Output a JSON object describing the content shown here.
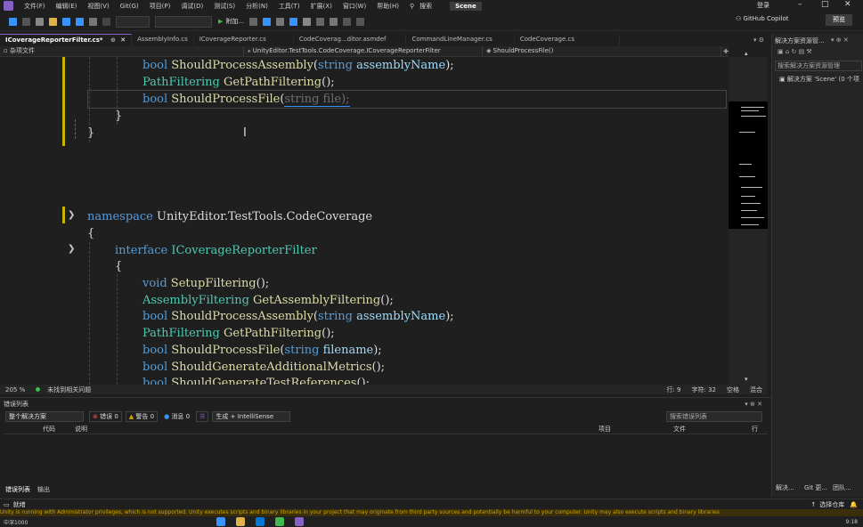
{
  "menu": {
    "items": [
      "文件(F)",
      "编辑(E)",
      "视图(V)",
      "Git(G)",
      "项目(P)",
      "调试(D)",
      "测试(S)",
      "分析(N)",
      "工具(T)",
      "扩展(X)",
      "窗口(W)",
      "帮助(H)"
    ],
    "search": "搜索",
    "solution_name": "Scene",
    "login": "登录"
  },
  "toolbar": {
    "attach": "附加...",
    "copilot": "GitHub Copilot",
    "preview": "预览"
  },
  "tabs": [
    {
      "label": "ICoverageReporterFilter.cs*",
      "active": true
    },
    {
      "label": "AssemblyInfo.cs"
    },
    {
      "label": "ICoverageReporter.cs"
    },
    {
      "label": "CodeCoverag...ditor.asmdef"
    },
    {
      "label": "CommandLineManager.cs"
    },
    {
      "label": "CodeCoverage.cs"
    }
  ],
  "navbar": {
    "project": "杂项文件",
    "type": "UnityEditor.TestTools.CodeCoverage.ICoverageReporterFilter",
    "member": "ShouldProcessFile()"
  },
  "code": {
    "l1": {
      "kw": "bool",
      "fn": "ShouldProcessAssembly",
      "ty": "string",
      "pm": "assemblyName",
      "end": ");"
    },
    "l2": {
      "ty": "PathFiltering",
      "fn": "GetPathFiltering",
      "end": "();"
    },
    "l3": {
      "kw": "bool",
      "fn": "ShouldProcessFile",
      "ghost": "string file);"
    },
    "close1": "}",
    "close2": "}",
    "ns_kw": "namespace",
    "ns_name": "UnityEditor.TestTools.CodeCoverage",
    "open1": "{",
    "if_kw": "interface",
    "if_name": "ICoverageReporterFilter",
    "open2": "{",
    "m1": {
      "kw": "void",
      "fn": "SetupFiltering",
      "end": "();"
    },
    "m2": {
      "ty": "AssemblyFiltering",
      "fn": "GetAssemblyFiltering",
      "end": "();"
    },
    "m3": {
      "kw": "bool",
      "fn": "ShouldProcessAssembly",
      "ty": "string",
      "pm": "assemblyName",
      "end": ");"
    },
    "m4": {
      "ty": "PathFiltering",
      "fn": "GetPathFiltering",
      "end": "();"
    },
    "m5": {
      "kw": "bool",
      "fn": "ShouldProcessFile",
      "ty": "string",
      "pm": "filename",
      "end": ");"
    },
    "m6": {
      "kw": "bool",
      "fn": "ShouldGenerateAdditionalMetrics",
      "end": "();"
    },
    "m7": {
      "kw": "bool",
      "fn": "ShouldGenerateTestReferences",
      "end": "();"
    }
  },
  "editor_status": {
    "zoom": "205 %",
    "issues": "未找到相关问题",
    "line": "行: 9",
    "char": "字符: 32",
    "space": "空格",
    "eol": "混合"
  },
  "error_list": {
    "title": "错误列表",
    "scope": "整个解决方案",
    "errors": "错误 0",
    "warnings": "警告 0",
    "messages": "消息 0",
    "build": "生成 + IntelliSense",
    "search_placeholder": "搜索错误列表",
    "columns": {
      "code": "代码",
      "desc": "说明",
      "project": "项目",
      "file": "文件",
      "line": "行"
    },
    "tab_errors": "错误列表",
    "tab_output": "输出"
  },
  "solution_explorer": {
    "title": "解决方案资源管...",
    "search": "搜索解决方案资源管理",
    "item": "解决方案 'Scene' (0 个项",
    "tab1": "解决...",
    "tab2": "Git 更...",
    "tab3": "团队..."
  },
  "statusbar": {
    "ready": "就绪",
    "scm": "选择仓库"
  },
  "banner": "Unity is running with Administrator privileges, which is not supported. Unity executes scripts and binary libraries in your project that may originate from third party sources and potentially be harmful to your computer. Unity may also execute scripts and binary libraries",
  "taskbar": {
    "weather": "中深1000",
    "time": "9:18"
  },
  "colors": {
    "accent": "#8661c5",
    "keyword": "#569cd6",
    "type": "#4ec9b0",
    "method": "#dcdcaa",
    "param": "#9cdcfe",
    "change_marker": "#c8b400"
  }
}
